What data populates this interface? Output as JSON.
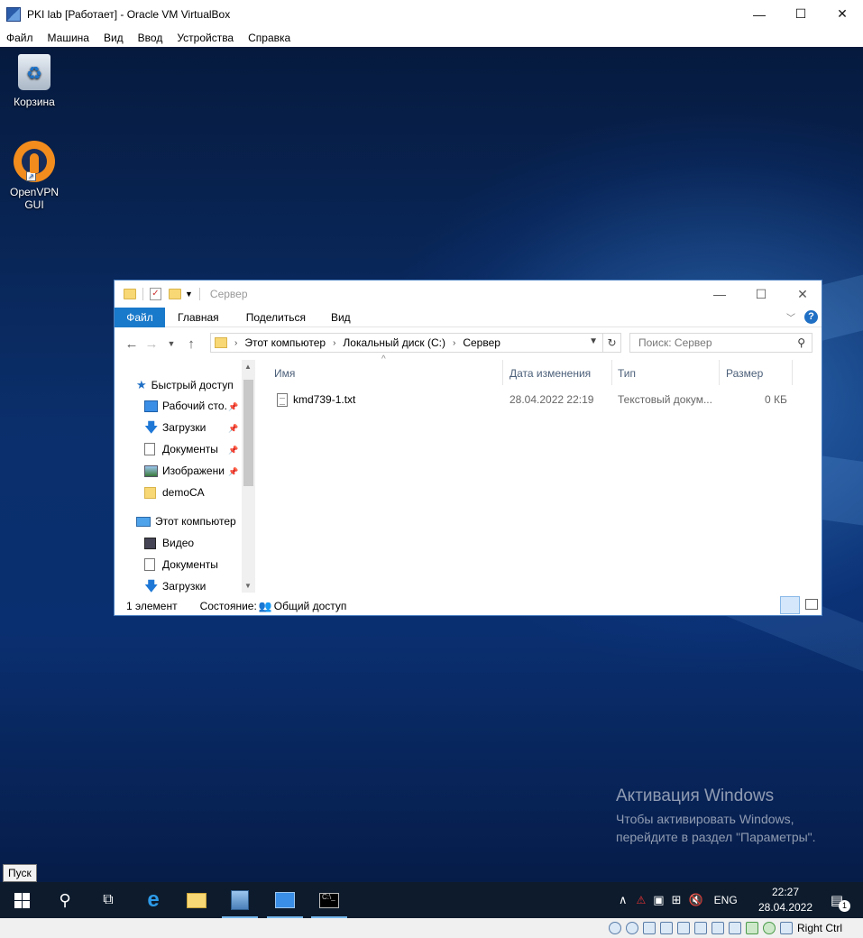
{
  "vbox": {
    "title": "PKI lab [Работает] - Oracle VM VirtualBox",
    "controls": {
      "minimize": "—",
      "maximize": "☐",
      "close": "✕"
    },
    "menu": [
      "Файл",
      "Машина",
      "Вид",
      "Ввод",
      "Устройства",
      "Справка"
    ],
    "host_key": "Right Ctrl"
  },
  "desktop": {
    "icons": [
      {
        "label": "Корзина",
        "icon": "recycle-bin-icon"
      },
      {
        "label": "OpenVPN GUI",
        "icon": "openvpn-icon"
      }
    ],
    "activation": {
      "title": "Активация Windows",
      "line1": "Чтобы активировать Windows,",
      "line2": "перейдите в раздел \"Параметры\"."
    }
  },
  "explorer": {
    "title": "Сервер",
    "ribbon_tabs": [
      "Файл",
      "Главная",
      "Поделиться",
      "Вид"
    ],
    "address": {
      "crumbs": [
        "Этот компьютер",
        "Локальный диск (C:)",
        "Сервер"
      ]
    },
    "search_placeholder": "Поиск: Сервер",
    "nav": {
      "quick_access": "Быстрый доступ",
      "items": [
        {
          "label": "Рабочий сто.",
          "icon": "desktop-icon",
          "pinned": true
        },
        {
          "label": "Загрузки",
          "icon": "download-icon",
          "pinned": true
        },
        {
          "label": "Документы",
          "icon": "document-icon",
          "pinned": true
        },
        {
          "label": "Изображени",
          "icon": "pictures-icon",
          "pinned": true
        },
        {
          "label": "demoCA",
          "icon": "folder-icon",
          "pinned": false
        }
      ],
      "this_pc": "Этот компьютер",
      "pc_items": [
        {
          "label": "Видео",
          "icon": "video-icon"
        },
        {
          "label": "Документы",
          "icon": "document-icon"
        },
        {
          "label": "Загрузки",
          "icon": "download-icon"
        }
      ]
    },
    "columns": [
      "Имя",
      "Дата изменения",
      "Тип",
      "Размер"
    ],
    "files": [
      {
        "name": "kmd739-1.txt",
        "date": "28.04.2022 22:19",
        "type": "Текстовый докум...",
        "size": "0 КБ"
      }
    ],
    "status": {
      "count": "1 элемент",
      "state_label": "Состояние:",
      "state_value": "Общий доступ"
    }
  },
  "taskbar": {
    "start_tooltip": "Пуск",
    "lang": "ENG",
    "time": "22:27",
    "date": "28.04.2022",
    "notifications": "1"
  },
  "colors": {
    "accent": "#1979ca",
    "taskbar": "#0d1b2c"
  }
}
